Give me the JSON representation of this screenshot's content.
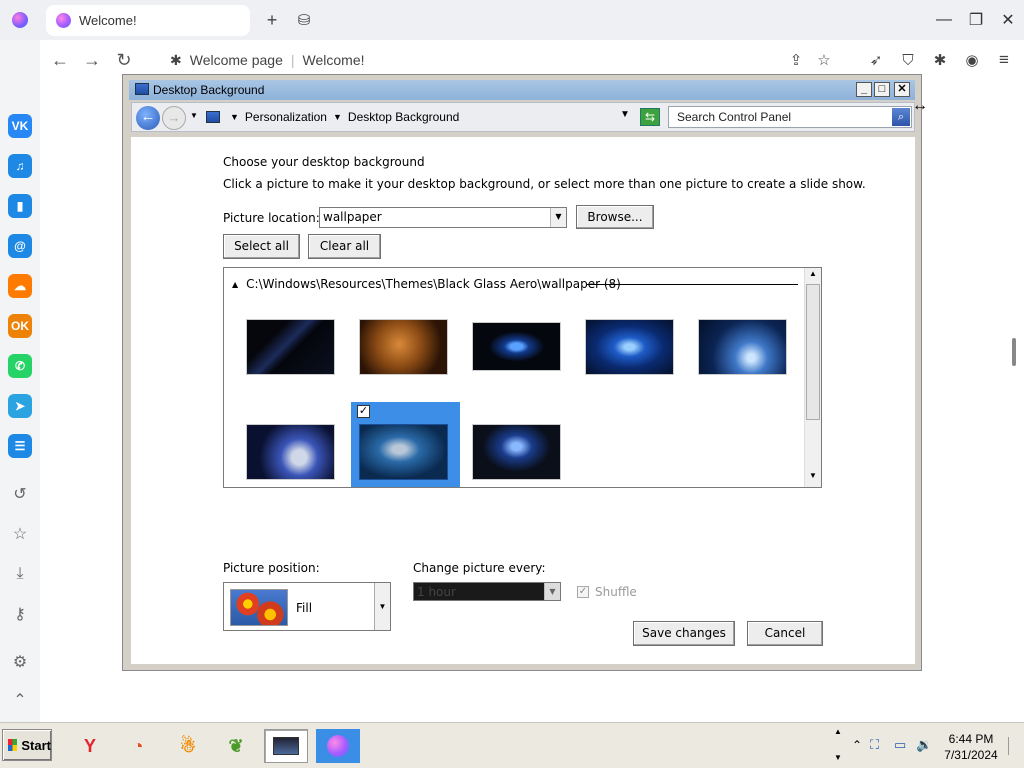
{
  "browser": {
    "tab_title": "Welcome!",
    "address_page": "Welcome page",
    "address_title": "Welcome!"
  },
  "sidebar": {
    "apps": [
      {
        "name": "vk",
        "label": "VK",
        "color": "#2787f5"
      },
      {
        "name": "music",
        "label": "♫",
        "color": "#1e88e5"
      },
      {
        "name": "stats",
        "label": "▮",
        "color": "#1e88e5"
      },
      {
        "name": "mail",
        "label": "@",
        "color": "#1e88e5"
      },
      {
        "name": "cloud",
        "label": "☁",
        "color": "#ff7a00"
      },
      {
        "name": "ok",
        "label": "OK",
        "color": "#ee8208"
      },
      {
        "name": "whatsapp",
        "label": "✆",
        "color": "#25d366"
      },
      {
        "name": "telegram",
        "label": "➤",
        "color": "#2aa3e0"
      },
      {
        "name": "list",
        "label": "☰",
        "color": "#1e88e5"
      }
    ]
  },
  "dialog": {
    "title": "Desktop Background",
    "breadcrumb": [
      "Personalization",
      "Desktop Background"
    ],
    "search_placeholder": "Search Control Panel",
    "heading": "Choose your desktop background",
    "instruction": "Click a picture to make it your desktop background, or select more than one picture to create a slide show.",
    "picture_location_label": "Picture location:",
    "picture_location_value": "wallpaper",
    "browse_label": "Browse...",
    "select_all_label": "Select all",
    "clear_all_label": "Clear all",
    "group_header": "C:\\Windows\\Resources\\Themes\\Black Glass Aero\\wallpaper (8)",
    "thumbnails": [
      {
        "id": 1,
        "selected": false
      },
      {
        "id": 2,
        "selected": false
      },
      {
        "id": 3,
        "selected": false
      },
      {
        "id": 4,
        "selected": false
      },
      {
        "id": 5,
        "selected": false
      },
      {
        "id": 6,
        "selected": false
      },
      {
        "id": 7,
        "selected": true
      },
      {
        "id": 8,
        "selected": false
      }
    ],
    "picture_position_label": "Picture position:",
    "picture_position_value": "Fill",
    "change_picture_label": "Change picture every:",
    "change_picture_value": "1 hour",
    "shuffle_label": "Shuffle",
    "save_label": "Save changes",
    "cancel_label": "Cancel"
  },
  "taskbar": {
    "start_label": "Start",
    "time": "6:44 PM",
    "date": "7/31/2024"
  }
}
